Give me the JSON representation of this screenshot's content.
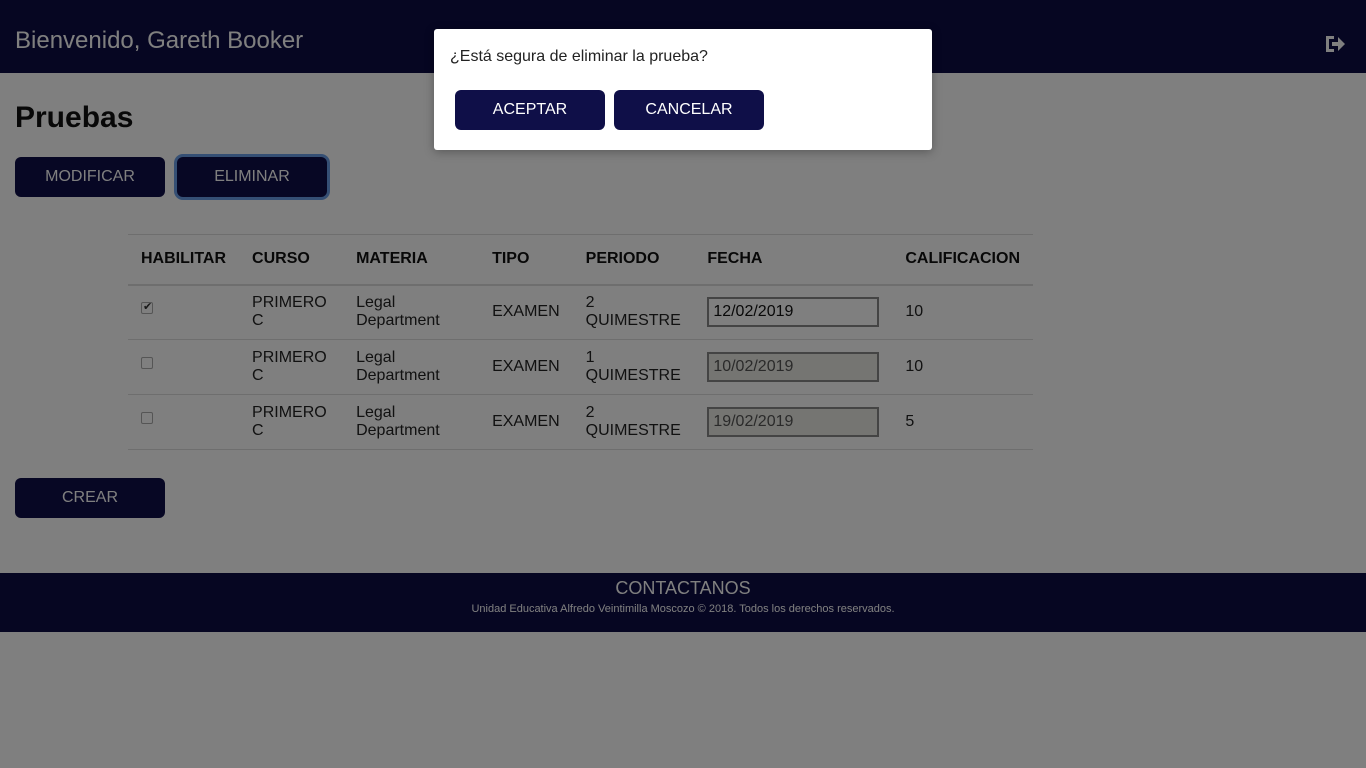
{
  "header": {
    "welcome": "Bienvenido, Gareth Booker",
    "logout_icon": "sign-out-icon"
  },
  "page": {
    "title": "Pruebas",
    "buttons": {
      "modificar": "MODIFICAR",
      "eliminar": "ELIMINAR",
      "crear": "CREAR"
    }
  },
  "table": {
    "headers": [
      "HABILITAR",
      "CURSO",
      "MATERIA",
      "TIPO",
      "PERIODO",
      "FECHA",
      "CALIFICACION"
    ],
    "rows": [
      {
        "checked": true,
        "curso": "PRIMERO C",
        "materia": "Legal Department",
        "tipo": "EXAMEN",
        "periodo": "2 QUIMESTRE",
        "fecha": "12/02/2019",
        "calificacion": "10",
        "enabled": true
      },
      {
        "checked": false,
        "curso": "PRIMERO C",
        "materia": "Legal Department",
        "tipo": "EXAMEN",
        "periodo": "1 QUIMESTRE",
        "fecha": "10/02/2019",
        "calificacion": "10",
        "enabled": false
      },
      {
        "checked": false,
        "curso": "PRIMERO C",
        "materia": "Legal Department",
        "tipo": "EXAMEN",
        "periodo": "2 QUIMESTRE",
        "fecha": "19/02/2019",
        "calificacion": "5",
        "enabled": false
      }
    ]
  },
  "footer": {
    "title": "CONTACTANOS",
    "copyright": "Unidad Educativa Alfredo Veintimilla Moscozo © 2018. Todos los derechos reservados."
  },
  "dialog": {
    "message": "¿Está segura de eliminar la prueba?",
    "accept": "ACEPTAR",
    "cancel": "CANCELAR"
  },
  "colors": {
    "navy": "#0d0d45",
    "overlay": "rgba(0,0,0,0.5)"
  }
}
